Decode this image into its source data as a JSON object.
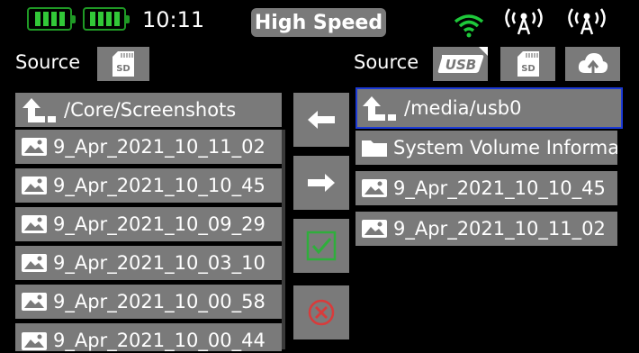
{
  "status": {
    "time": "10:11",
    "mode": "High Speed",
    "icons": [
      "battery-icon",
      "battery-icon",
      "wifi-icon",
      "antenna-icon",
      "antenna-icon"
    ],
    "colors": {
      "battery": "#32c838",
      "wifi": "#1ec83a"
    }
  },
  "left": {
    "source_label": "Source",
    "source_buttons": [
      {
        "label": "SD",
        "icon": "sd-card-icon"
      }
    ],
    "path": "/Core/Screenshots",
    "files": [
      "9_Apr_2021_10_11_02",
      "9_Apr_2021_10_10_45",
      "9_Apr_2021_10_09_29",
      "9_Apr_2021_10_03_10",
      "9_Apr_2021_10_00_58",
      "9_Apr_2021_10_00_44"
    ]
  },
  "right": {
    "source_label": "Source",
    "source_buttons": [
      {
        "label": "USB",
        "icon": "usb-icon"
      },
      {
        "label": "SD",
        "icon": "sd-card-icon"
      },
      {
        "label": "",
        "icon": "cloud-upload-icon"
      }
    ],
    "path": "/media/usb0",
    "entries": [
      {
        "name": "System Volume Information",
        "type": "folder"
      },
      {
        "name": "9_Apr_2021_10_10_45",
        "type": "image"
      },
      {
        "name": "9_Apr_2021_10_11_02",
        "type": "image"
      }
    ]
  },
  "actions": [
    "arrow-left-icon",
    "arrow-right-icon",
    "checkbox-icon",
    "cancel-icon"
  ]
}
